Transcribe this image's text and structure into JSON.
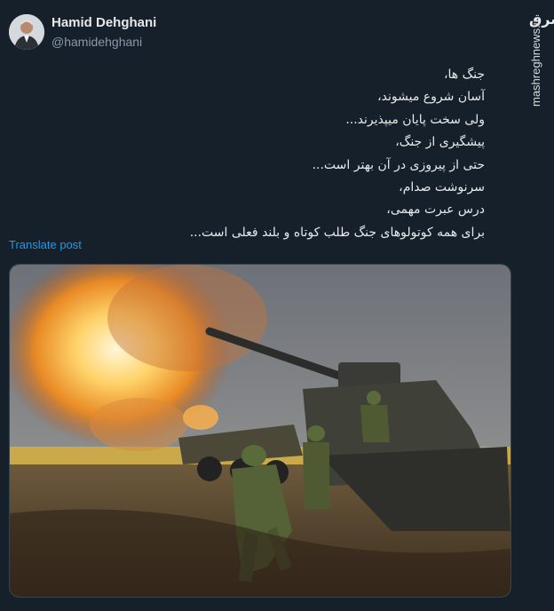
{
  "author": {
    "display_name": "Hamid Dehghani",
    "handle": "@hamidehghani"
  },
  "tweet": {
    "lines": [
      "جنگ ها،",
      "آسان شروع میشوند،",
      "ولی سخت پایان میپذیرند...",
      "پیشگیری از جنگ،",
      "حتی از پیروزی در آن بهتر است...",
      "سرنوشت صدام،",
      "درس عبرت مهمی،",
      "برای همه کوتولوهای جنگ طلب کوتاه و بلند فعلی است..."
    ],
    "translate_label": "Translate post"
  },
  "watermark": {
    "site": "mashreghnews.ir",
    "logo": "مشرق"
  },
  "icons": {
    "avatar": "avatar",
    "logo": "mashregh-logo"
  },
  "colors": {
    "background": "#15202b",
    "link": "#1d9bf0",
    "muted": "#8b98a5"
  }
}
